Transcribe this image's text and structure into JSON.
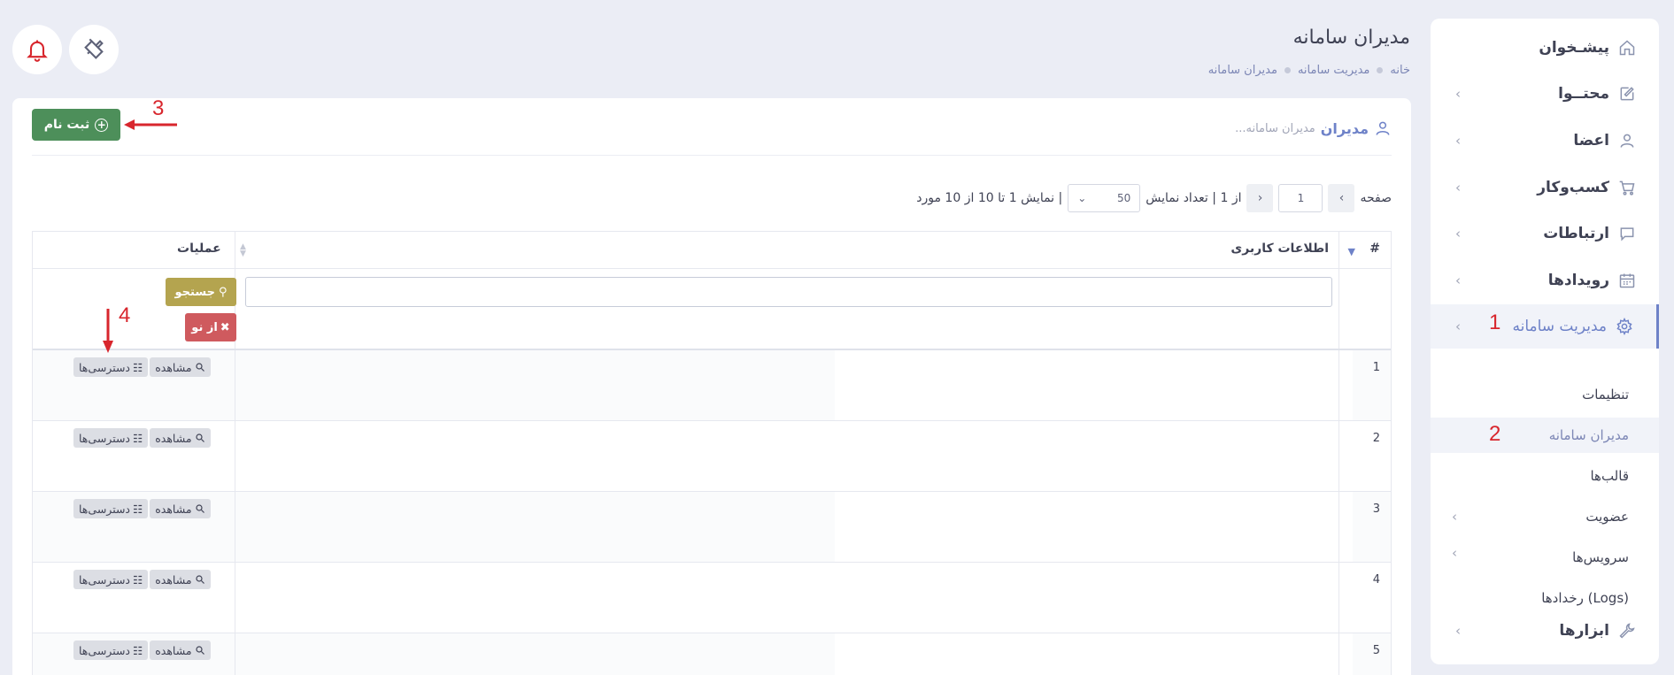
{
  "sidebar": {
    "items": [
      {
        "label": "پیشـخوان",
        "icon": "home-icon"
      },
      {
        "label": "محتــوا",
        "icon": "edit-icon"
      },
      {
        "label": "اعضا",
        "icon": "users-icon"
      },
      {
        "label": "کسب‌وکار",
        "icon": "cart-icon"
      },
      {
        "label": "ارتباطات",
        "icon": "chat-icon"
      },
      {
        "label": "رویدادها",
        "icon": "calendar-icon"
      },
      {
        "label": "مدیریت سامانه",
        "icon": "gear-icon"
      },
      {
        "label": "ابزارها",
        "icon": "wrench-icon"
      }
    ],
    "sub_items": [
      {
        "label": "تنظیمات"
      },
      {
        "label": "مدیران سامانه"
      },
      {
        "label": "قالب‌ها"
      },
      {
        "label": "عضویت"
      },
      {
        "label": "سرویس‌ها"
      },
      {
        "label": "رخدادها (Logs)"
      }
    ]
  },
  "annotations": {
    "one": "1",
    "two": "2",
    "three": "3",
    "four": "4"
  },
  "header": {
    "title": "مدیران سامانه",
    "breadcrumb": [
      "خانه",
      "مدیریت سامانه",
      "مدیران سامانه"
    ],
    "icons": [
      "bell-icon",
      "paint-icon"
    ]
  },
  "card": {
    "title": "مدیران",
    "subtitle": "مدیران سامانه...",
    "register_button": "ثبت نام"
  },
  "pager": {
    "page_label": "صفحه",
    "page_value": "1",
    "of_label": "از 1 | تعداد نمایش",
    "page_size": "50",
    "summary": "| نمایش 1 تا 10 از 10 مورد"
  },
  "table": {
    "headers": {
      "num": "#",
      "user_info": "اطلاعات کاربری",
      "operations": "عملیات"
    },
    "search_button": "جستجو",
    "reset_button": "از نو",
    "view_button": "مشاهده",
    "access_button": "دسترسی‌ها",
    "rows": [
      "1",
      "2",
      "3",
      "4",
      "5"
    ]
  },
  "colors": {
    "accent": "#6e82c8",
    "register": "#4d8f5a",
    "search": "#b4a44f",
    "reset": "#cf5a5e",
    "annotation": "#d8262d"
  }
}
